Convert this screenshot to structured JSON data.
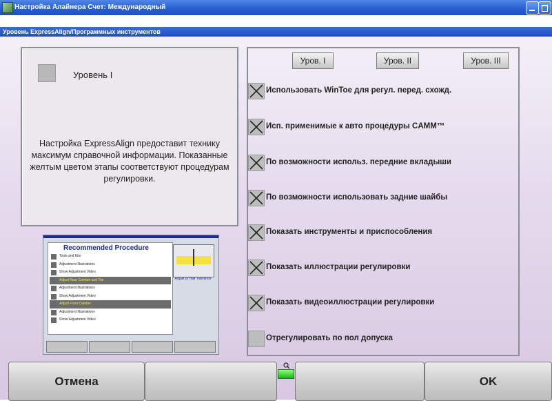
{
  "window": {
    "title": "Настройка Алайнера  Счет: Международный"
  },
  "subtitle": "Уровень ExpressAlign/Программных инструментов",
  "left_panel": {
    "level_title": "Уровень I",
    "description": "Настройка ExpressAlign предоставит технику максимум справочной информации. Показанные желтым цветом этапы соответствуют процедурам регулировки."
  },
  "thumbnail": {
    "title": "Recommended Procedure",
    "rows": [
      {
        "text": "Tools and Kits",
        "highlight": false
      },
      {
        "text": "Adjustment Illustrations",
        "highlight": false
      },
      {
        "text": "Show Adjustment Video",
        "highlight": false
      },
      {
        "text": "Adjust Rear Camber and Toe",
        "highlight": true
      },
      {
        "text": "Adjustment Illustrations",
        "highlight": false
      },
      {
        "text": "Show Adjustment Video",
        "highlight": false
      },
      {
        "text": "Adjust Front Camber",
        "highlight": true
      },
      {
        "text": "Adjustment Illustrations",
        "highlight": false
      },
      {
        "text": "Show Adjustment Video",
        "highlight": false
      }
    ],
    "side_caption": "Adjust to Half Tolerance"
  },
  "level_buttons": [
    "Уров. I",
    "Уров. II",
    "Уров. III"
  ],
  "options": [
    {
      "label": "Использовать WinToe для регул. перед. схожд.",
      "checked": true
    },
    {
      "label": "Исп. применимые к авто процедуры CAMM™",
      "checked": true
    },
    {
      "label": "По возможности использ. передние вкладыши",
      "checked": true
    },
    {
      "label": "По возможности использовать задние шайбы",
      "checked": true
    },
    {
      "label": "Показать инструменты и приспособления",
      "checked": true
    },
    {
      "label": "Показать иллюстрации регулировки",
      "checked": true
    },
    {
      "label": "Показать видеоиллюстрации регулировки",
      "checked": true
    },
    {
      "label": "Отрегулировать по пол допуска",
      "checked": false
    }
  ],
  "bottom_bar": {
    "cancel_label": "Отмена",
    "blank_1": "",
    "blank_2": "",
    "ok_label": "OK"
  },
  "colors": {
    "title_blue": "#2a5fd0",
    "status_green": "#18b418",
    "highlight_yellow": "#f5ea4a"
  }
}
